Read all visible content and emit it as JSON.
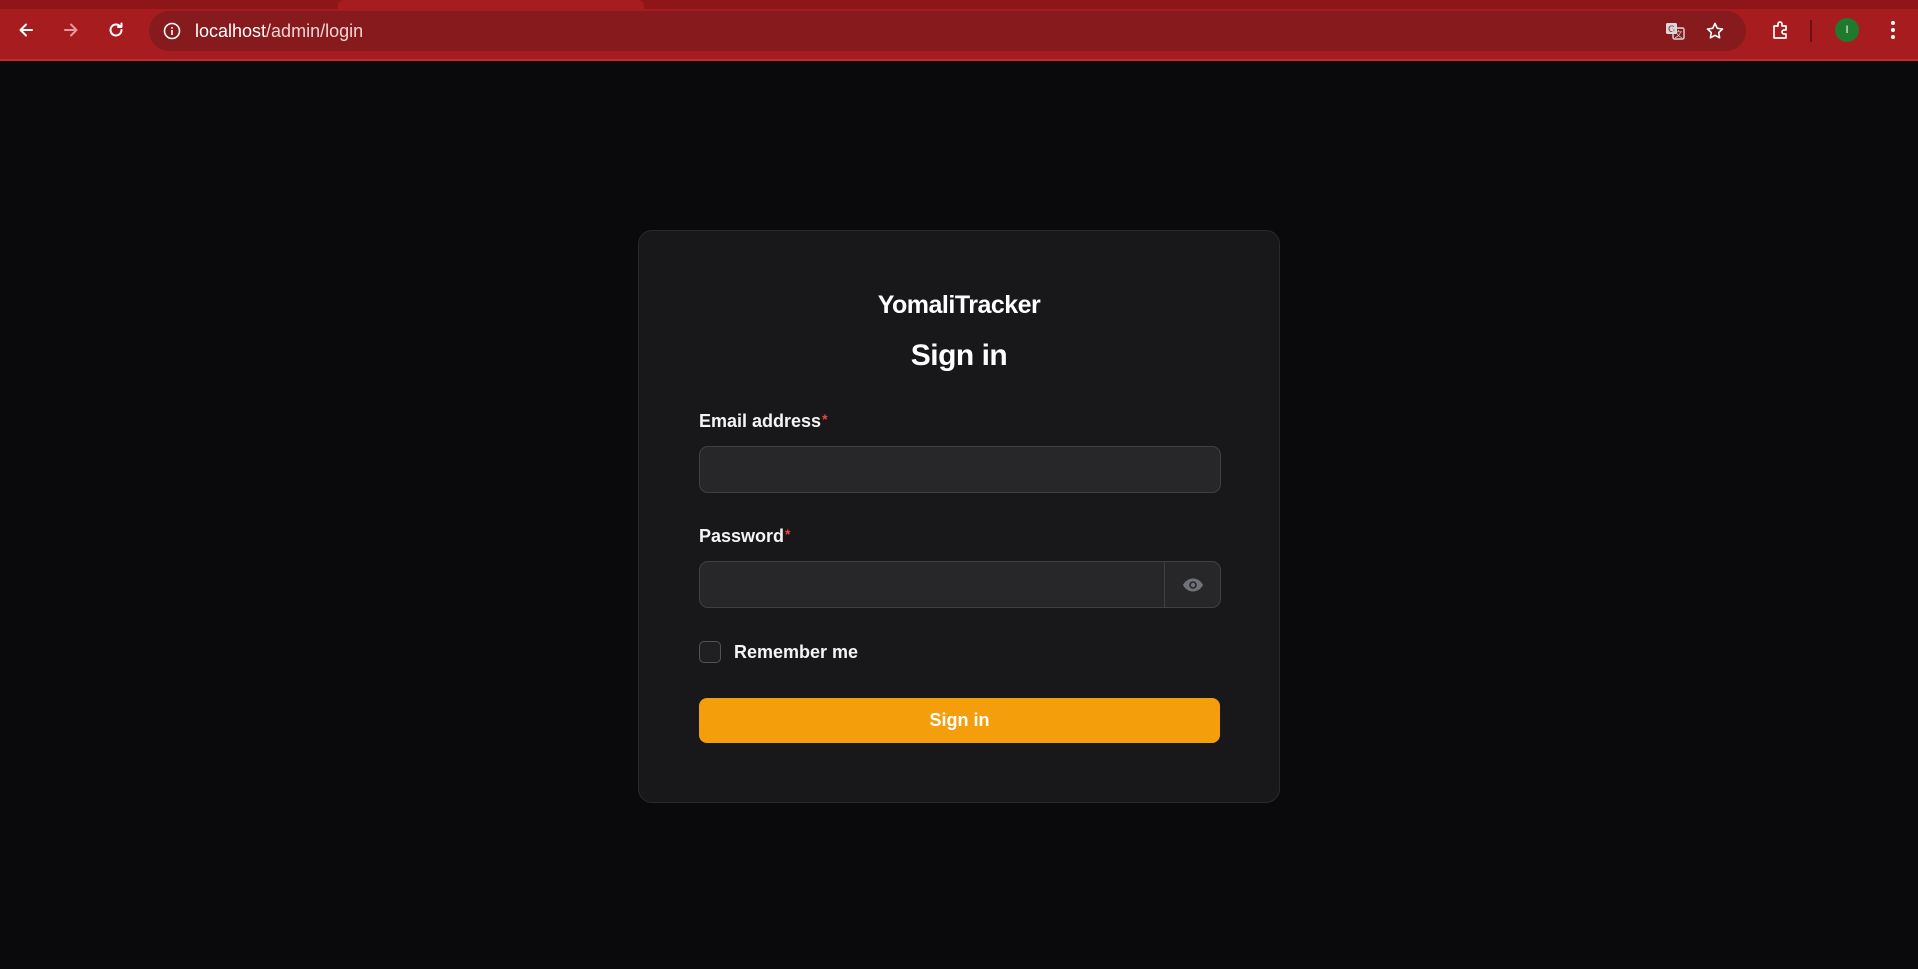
{
  "browser": {
    "url_host": "localhost",
    "url_path": "/admin/login",
    "profile_initial": "I",
    "colors": {
      "frame": "#a61c1f",
      "omnibox": "#861a1d"
    },
    "icons": {
      "back": "arrow-left-icon",
      "forward": "arrow-right-icon",
      "reload": "reload-icon",
      "site_info": "info-icon",
      "translate": "translate-icon",
      "bookmark": "star-icon",
      "extensions": "puzzle-icon",
      "menu": "kebab-menu-icon"
    }
  },
  "login": {
    "brand": "YomaliTracker",
    "heading": "Sign in",
    "email": {
      "label": "Email address",
      "required_mark": "*",
      "value": ""
    },
    "password": {
      "label": "Password",
      "required_mark": "*",
      "value": ""
    },
    "remember_label": "Remember me",
    "remember_checked": false,
    "submit_label": "Sign in",
    "colors": {
      "accent": "#f59e0b",
      "required": "#ef4444",
      "card": "#18181b",
      "page": "#0a0a0c"
    }
  }
}
